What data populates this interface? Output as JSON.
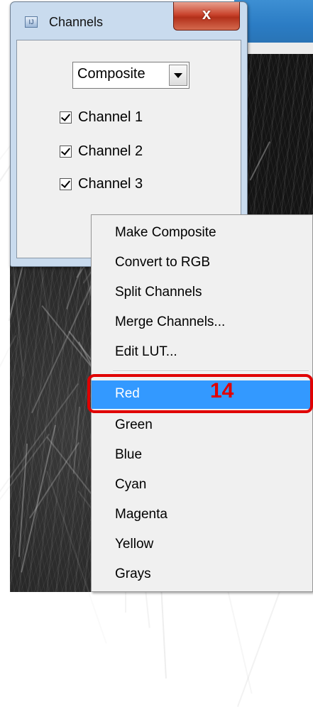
{
  "dialog": {
    "title": "Channels",
    "close_label": "x",
    "mode_select": {
      "value": "Composite"
    },
    "channels": [
      {
        "label": "Channel 1",
        "checked": true
      },
      {
        "label": "Channel 2",
        "checked": true
      },
      {
        "label": "Channel 3",
        "checked": true
      }
    ]
  },
  "menu": {
    "items": [
      {
        "label": "Make Composite"
      },
      {
        "label": "Convert to RGB"
      },
      {
        "label": "Split Channels"
      },
      {
        "label": "Merge Channels..."
      },
      {
        "label": "Edit LUT..."
      },
      {
        "label": "Red",
        "selected": true
      },
      {
        "label": "Green"
      },
      {
        "label": "Blue"
      },
      {
        "label": "Cyan"
      },
      {
        "label": "Magenta"
      },
      {
        "label": "Yellow"
      },
      {
        "label": "Grays"
      }
    ]
  },
  "annotation": {
    "step_number": "14",
    "color": "#e00000"
  },
  "colors": {
    "selection": "#3399ff",
    "close_button": "#c9442d"
  }
}
